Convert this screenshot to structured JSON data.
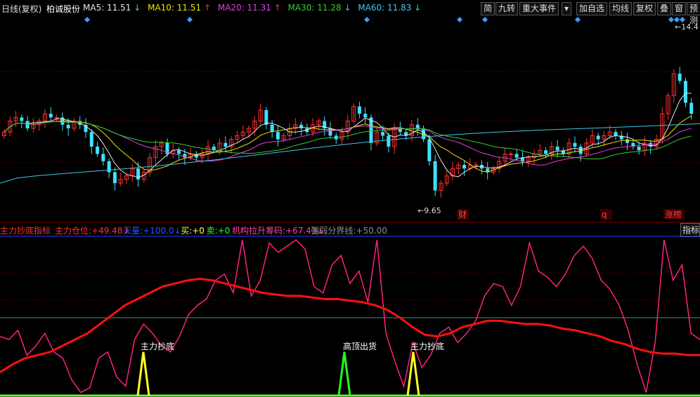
{
  "header": {
    "chart_type_label": "日线(复权)",
    "stock_name": "柏诚股份",
    "ma": [
      {
        "label": "MA5:",
        "value": "11.51",
        "arrow": "↓",
        "color": "#e6e6e6"
      },
      {
        "label": "MA10:",
        "value": "11.51",
        "arrow": "↑",
        "color": "#e8e800"
      },
      {
        "label": "MA20:",
        "value": "11.31",
        "arrow": "↑",
        "color": "#e040e0"
      },
      {
        "label": "MA30:",
        "value": "11.28",
        "arrow": "↓",
        "color": "#30d030"
      },
      {
        "label": "MA60:",
        "value": "11.83",
        "arrow": "↓",
        "color": "#40c8e8"
      }
    ],
    "buttons": [
      "简",
      "九转",
      "重大事件",
      "▾",
      "加自选",
      "均线",
      "复权",
      "叠",
      "窗",
      "预测",
      "□"
    ]
  },
  "price_chart": {
    "high_label": "14.4",
    "low_label": "9.65",
    "event_labels": [
      "财",
      "q",
      "涨榜"
    ]
  },
  "indicator": {
    "title": "主力抄底指标",
    "fields": [
      {
        "label": "主力仓位:",
        "value": "+49.48",
        "arrow": "↓",
        "color": "#ff3030"
      },
      {
        "label": "天量:",
        "value": "+100.0",
        "arrow": "↓",
        "color": "#3050ff"
      },
      {
        "label": "买:",
        "value": "+0",
        "arrow": "",
        "color": "#ffff40"
      },
      {
        "label": "卖:",
        "value": "+0",
        "arrow": "",
        "color": "#30ff30"
      },
      {
        "label": "机构拉升筹码:",
        "value": "+67.43",
        "arrow": "↓",
        "color": "#ff40a0"
      },
      {
        "label": "强弱分界线:",
        "value": "+50.00",
        "arrow": "",
        "color": "#909090"
      }
    ],
    "right_tab": "指标",
    "signals": [
      {
        "label": "主力抄底",
        "type": "buy"
      },
      {
        "label": "高顶出货",
        "type": "sell"
      },
      {
        "label": "主力抄底",
        "type": "buy"
      }
    ]
  },
  "chart_data": [
    {
      "type": "candlestick",
      "title": "",
      "ylim": [
        9.3,
        14.6
      ],
      "series_names": [
        "MA5",
        "MA10",
        "MA20",
        "MA30",
        "MA60"
      ],
      "notes": "approximate daily candles read visually",
      "closes": [
        11.6,
        11.9,
        12.0,
        11.9,
        11.7,
        11.8,
        11.9,
        12.1,
        12.0,
        12.0,
        11.8,
        11.7,
        11.9,
        11.8,
        11.6,
        11.2,
        11.0,
        10.8,
        10.5,
        10.2,
        10.3,
        10.4,
        10.6,
        10.3,
        10.5,
        10.9,
        11.2,
        11.3,
        11.0,
        11.1,
        11.0,
        10.9,
        11.0,
        10.9,
        11.0,
        11.2,
        11.1,
        11.3,
        11.2,
        11.4,
        11.5,
        11.6,
        11.7,
        11.9,
        12.2,
        11.8,
        11.6,
        11.4,
        11.5,
        11.7,
        11.8,
        11.7,
        11.6,
        11.8,
        11.9,
        11.7,
        11.5,
        11.4,
        11.6,
        11.9,
        12.3,
        12.1,
        12.0,
        11.3,
        11.6,
        11.5,
        11.2,
        11.7,
        11.6,
        11.5,
        11.8,
        11.7,
        11.4,
        10.8,
        10.0,
        10.2,
        10.4,
        10.6,
        10.7,
        10.6,
        10.7,
        10.7,
        10.6,
        10.5,
        10.6,
        10.8,
        11.0,
        11.0,
        10.9,
        10.8,
        10.9,
        11.0,
        11.1,
        11.0,
        11.2,
        11.1,
        11.0,
        11.3,
        11.2,
        11.0,
        11.3,
        11.5,
        11.4,
        11.5,
        11.6,
        11.5,
        11.4,
        11.3,
        11.2,
        11.1,
        11.3,
        11.2,
        11.4,
        12.1,
        12.6,
        13.2,
        13.0,
        12.4,
        12.1
      ],
      "ma60_start": 10.2,
      "ma60_end": 11.83
    },
    {
      "type": "line",
      "title": "",
      "ylim": [
        0,
        100
      ],
      "series": [
        {
          "name": "主力仓位",
          "values": [
            15,
            20,
            24,
            26,
            28,
            32,
            36,
            40,
            46,
            52,
            58,
            62,
            66,
            70,
            72,
            74,
            75,
            74,
            72,
            70,
            68,
            66,
            65,
            64,
            64,
            63,
            62,
            62,
            61,
            60,
            58,
            55,
            50,
            44,
            39,
            38,
            40,
            44,
            46,
            48,
            48,
            47,
            46,
            46,
            45,
            43,
            42,
            40,
            38,
            35,
            33,
            30,
            28,
            27,
            27,
            26,
            26
          ]
        },
        {
          "name": "机构拉升筹码",
          "values": [
            38,
            36,
            42,
            26,
            32,
            40,
            28,
            24,
            10,
            2,
            5,
            24,
            28,
            12,
            6,
            36,
            46,
            40,
            32,
            28,
            38,
            52,
            58,
            62,
            74,
            78,
            66,
            100,
            64,
            74,
            98,
            92,
            96,
            100,
            94,
            70,
            66,
            84,
            90,
            72,
            80,
            60,
            100,
            40,
            22,
            6,
            34,
            18,
            26,
            40,
            44,
            34,
            40,
            48,
            64,
            72,
            70,
            58,
            70,
            98,
            80,
            76,
            70,
            78,
            90,
            96,
            88,
            74,
            68,
            58,
            42,
            20,
            2,
            34,
            100,
            74,
            84,
            40,
            36
          ]
        },
        {
          "name": "强弱分界线",
          "values": [
            50
          ]
        }
      ]
    }
  ]
}
